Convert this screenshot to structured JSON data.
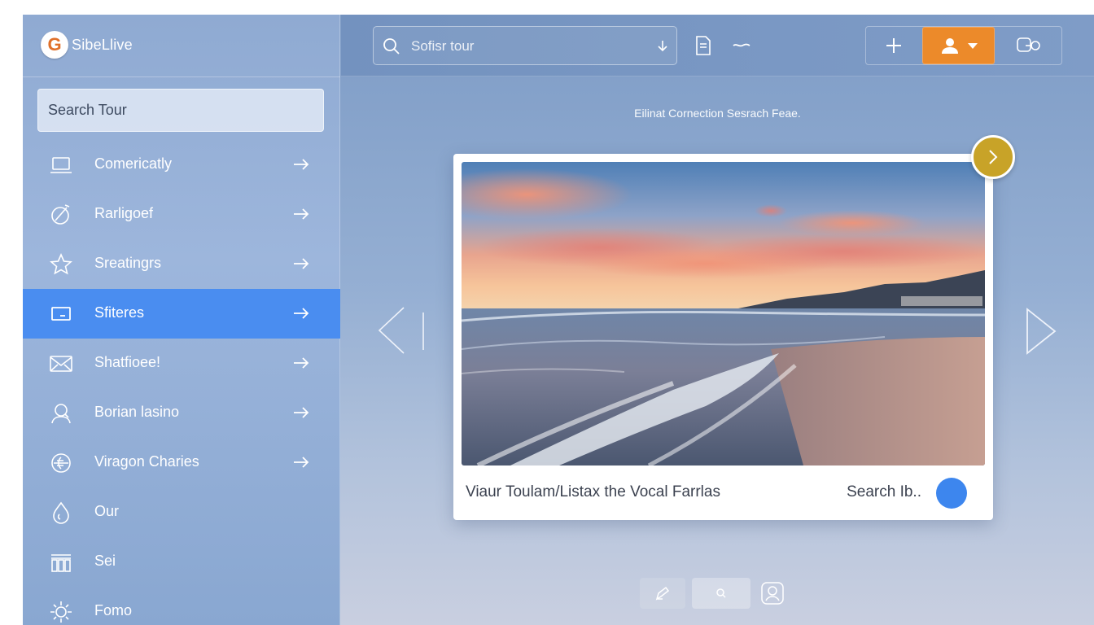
{
  "brand": {
    "name": "SibeLlive",
    "logo_letter": "G",
    "logo_color": "#e0702a"
  },
  "sidebar": {
    "search_label": "Search Tour",
    "items": [
      {
        "label": "Comericatly",
        "icon": "laptop-icon",
        "arrow": true,
        "active": false
      },
      {
        "label": "Rarligoef",
        "icon": "compass-icon",
        "arrow": true,
        "active": false
      },
      {
        "label": "Sreatingrs",
        "icon": "star-icon",
        "arrow": true,
        "active": false
      },
      {
        "label": "Sfiteres",
        "icon": "screen-icon",
        "arrow": true,
        "active": true
      },
      {
        "label": "Shatfioee!",
        "icon": "mail-icon",
        "arrow": true,
        "active": false
      },
      {
        "label": "Borian lasino",
        "icon": "user-search-icon",
        "arrow": true,
        "active": false
      },
      {
        "label": "Viragon Charies",
        "icon": "globe-icon",
        "arrow": true,
        "active": false
      },
      {
        "label": "Our",
        "icon": "drop-icon",
        "arrow": false,
        "active": false
      },
      {
        "label": "Sei",
        "icon": "columns-icon",
        "arrow": false,
        "active": false
      },
      {
        "label": "Fomo",
        "icon": "sun-icon",
        "arrow": false,
        "active": false
      }
    ],
    "active_color": "#4a8df0"
  },
  "topbar": {
    "search_placeholder": "Sofisr tour",
    "accent": "#ec8a2a"
  },
  "main": {
    "caption": "Eilinat Cornection Sesrach Feae.",
    "card": {
      "caption": "Viaur Toulam/Listax the Vocal Farrlas",
      "search_label": "Search Ib..",
      "dot_color": "#3d86ee",
      "badge_color": "#c8a328"
    }
  }
}
